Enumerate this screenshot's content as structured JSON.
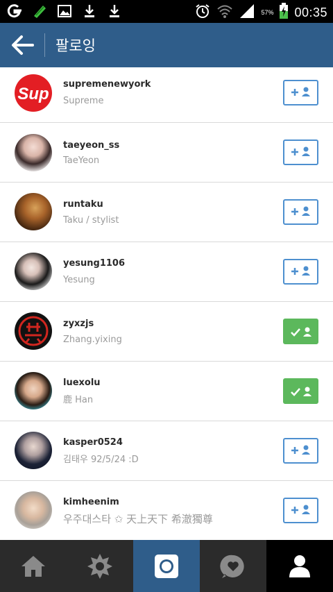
{
  "status_bar": {
    "time": "00:35",
    "battery": "57%"
  },
  "header": {
    "title": "팔로잉"
  },
  "users": [
    {
      "username": "supremenewyork",
      "fullname": "Supreme",
      "following": false,
      "avatar_text": "Sup"
    },
    {
      "username": "taeyeon_ss",
      "fullname": "TaeYeon",
      "following": false
    },
    {
      "username": "runtaku",
      "fullname": "Taku / stylist",
      "following": false
    },
    {
      "username": "yesung1106",
      "fullname": "Yesung",
      "following": false
    },
    {
      "username": "zyxzjs",
      "fullname": "Zhang.yixing",
      "following": true
    },
    {
      "username": "luexolu",
      "fullname": "鹿 Han",
      "following": true
    },
    {
      "username": "kasper0524",
      "fullname": "김태우 92/5/24 :D",
      "following": false
    },
    {
      "username": "kimheenim",
      "fullname": "우주대스타 ✩ 天上天下 希澈獨尊",
      "following": false
    }
  ],
  "bottom_tabs": [
    {
      "name": "home",
      "icon": "home-icon",
      "active": false
    },
    {
      "name": "explore",
      "icon": "explore-icon",
      "active": false
    },
    {
      "name": "camera",
      "icon": "camera-icon",
      "active": true
    },
    {
      "name": "news",
      "icon": "heart-bubble-icon",
      "active": false
    },
    {
      "name": "profile",
      "icon": "profile-icon",
      "active": false,
      "selected": true
    }
  ],
  "colors": {
    "header": "#2f5d8a",
    "follow_border": "#4d8fcf",
    "following_fill": "#5cb85c",
    "tabbar": "#2b2b2b",
    "camera_tab": "#2f5d8a",
    "profile_tab": "#000000"
  }
}
